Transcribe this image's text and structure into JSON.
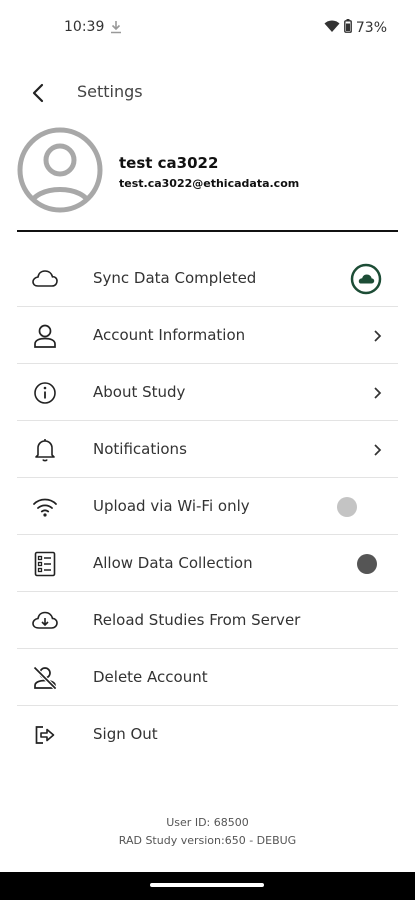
{
  "status_bar": {
    "time": "10:39",
    "battery": "73%"
  },
  "header": {
    "title": "Settings"
  },
  "profile": {
    "name": "test ca3022",
    "email": "test.ca3022@ethicadata.com"
  },
  "menu": [
    {
      "label": "Sync Data Completed",
      "icon": "cloud-icon",
      "trailing": "sync-status"
    },
    {
      "label": "Account Information",
      "icon": "person-icon",
      "trailing": "chevron"
    },
    {
      "label": "About Study",
      "icon": "info-icon",
      "trailing": "chevron"
    },
    {
      "label": "Notifications",
      "icon": "bell-icon",
      "trailing": "chevron"
    },
    {
      "label": "Upload via Wi-Fi only",
      "icon": "wifi-icon",
      "trailing": "toggle",
      "toggle_on": false
    },
    {
      "label": "Allow Data Collection",
      "icon": "checklist-icon",
      "trailing": "toggle",
      "toggle_on": true
    },
    {
      "label": "Reload Studies From Server",
      "icon": "cloud-download-icon",
      "trailing": "none"
    },
    {
      "label": "Delete Account",
      "icon": "person-off-icon",
      "trailing": "none"
    },
    {
      "label": "Sign Out",
      "icon": "sign-out-icon",
      "trailing": "none"
    }
  ],
  "footer": {
    "user_id": "User ID: 68500",
    "version": "RAD Study version:650 - DEBUG"
  },
  "colors": {
    "sync_green": "#1d4d36",
    "toggle_off": "#c4c4c4",
    "toggle_on": "#555555"
  }
}
